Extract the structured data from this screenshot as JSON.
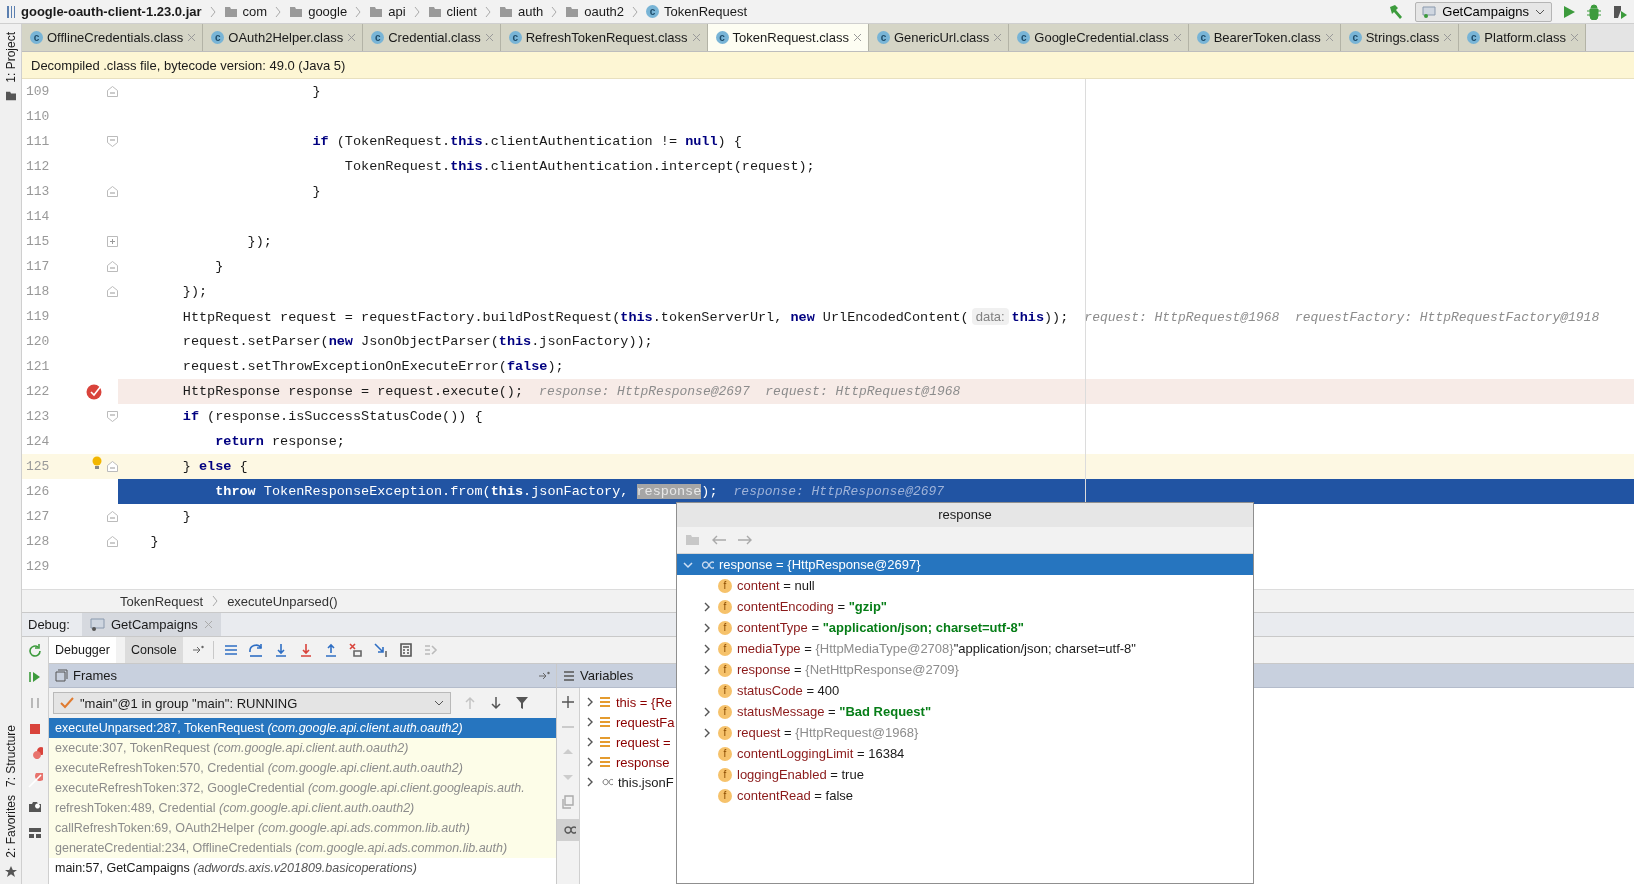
{
  "breadcrumb": {
    "root": "google-oauth-client-1.23.0.jar",
    "folders": [
      "com",
      "google",
      "api",
      "client",
      "auth",
      "oauth2"
    ],
    "class_icon": "c",
    "class_name": "TokenRequest"
  },
  "assign": "=",
  "run_config": "GetCampaigns",
  "left_strip": {
    "top": [
      "1: Project"
    ],
    "bottom": [
      "7: Structure",
      "2: Favorites"
    ]
  },
  "tabs": [
    {
      "icon": "c",
      "label": "OfflineCredentials.class",
      "selected": false
    },
    {
      "icon": "c",
      "label": "OAuth2Helper.class",
      "selected": false
    },
    {
      "icon": "c",
      "label": "Credential.class",
      "selected": false
    },
    {
      "icon": "c",
      "label": "RefreshTokenRequest.class",
      "selected": false
    },
    {
      "icon": "c",
      "label": "TokenRequest.class",
      "selected": true
    },
    {
      "icon": "c",
      "label": "GenericUrl.class",
      "selected": false
    },
    {
      "icon": "c",
      "label": "GoogleCredential.class",
      "selected": false
    },
    {
      "icon": "c",
      "label": "BearerToken.class",
      "selected": false
    },
    {
      "icon": "c",
      "label": "Strings.class",
      "selected": false
    },
    {
      "icon": "c",
      "label": "Platform.class",
      "selected": false
    }
  ],
  "banner": "Decompiled .class file, bytecode version: 49.0 (Java 5)",
  "code_lines": [
    {
      "number": "109",
      "kind": "plain",
      "fold": {
        "kind": "end"
      },
      "tokens": [
        {
          "kind": "plain",
          "t": "                        }"
        }
      ]
    },
    {
      "number": "110",
      "kind": "plain"
    },
    {
      "number": "111",
      "kind": "plain",
      "fold": {
        "kind": "start"
      },
      "tokens": [
        {
          "kind": "keyword",
          "t": "                        if"
        },
        {
          "kind": "plain",
          "t": " (TokenRequest."
        },
        {
          "kind": "keyword",
          "t": "this"
        },
        {
          "kind": "plain",
          "t": ".clientAuthentication != "
        },
        {
          "kind": "keyword",
          "t": "null"
        },
        {
          "kind": "plain",
          "t": ") {"
        }
      ]
    },
    {
      "number": "112",
      "kind": "plain",
      "tokens": [
        {
          "kind": "plain",
          "t": "                            TokenRequest."
        },
        {
          "kind": "keyword",
          "t": "this"
        },
        {
          "kind": "plain",
          "t": ".clientAuthentication.intercept(request);"
        }
      ]
    },
    {
      "number": "113",
      "kind": "plain",
      "fold": {
        "kind": "end"
      },
      "tokens": [
        {
          "kind": "plain",
          "t": "                        }"
        }
      ]
    },
    {
      "number": "114",
      "kind": "plain"
    },
    {
      "number": "115",
      "kind": "plain",
      "fold": {
        "kind": "collapsed"
      },
      "tokens": [
        {
          "kind": "plain",
          "t": "                });"
        }
      ]
    },
    {
      "number": "117",
      "kind": "plain",
      "fold": {
        "kind": "end"
      },
      "tokens": [
        {
          "kind": "plain",
          "t": "            }"
        }
      ]
    },
    {
      "number": "118",
      "kind": "plain",
      "fold": {
        "kind": "end"
      },
      "tokens": [
        {
          "kind": "plain",
          "t": "        });"
        }
      ]
    },
    {
      "number": "119",
      "kind": "plain",
      "tokens": [
        {
          "kind": "plain",
          "t": "        HttpRequest request = requestFactory.buildPostRequest("
        },
        {
          "kind": "keyword",
          "t": "this"
        },
        {
          "kind": "plain",
          "t": ".tokenServerUrl, "
        },
        {
          "kind": "keyword",
          "t": "new"
        },
        {
          "kind": "plain",
          "t": " UrlEncodedContent("
        },
        {
          "kind": "param",
          "t": "data:"
        },
        {
          "kind": "keyword",
          "t": "this"
        },
        {
          "kind": "plain",
          "t": "));"
        },
        {
          "kind": "hint",
          "t": "request: HttpRequest@1968  requestFactory: HttpRequestFactory@1918"
        }
      ]
    },
    {
      "number": "120",
      "kind": "plain",
      "tokens": [
        {
          "kind": "plain",
          "t": "        request.setParser("
        },
        {
          "kind": "keyword",
          "t": "new"
        },
        {
          "kind": "plain",
          "t": " JsonObjectParser("
        },
        {
          "kind": "keyword",
          "t": "this"
        },
        {
          "kind": "plain",
          "t": ".jsonFactory));"
        }
      ]
    },
    {
      "number": "121",
      "kind": "plain",
      "tokens": [
        {
          "kind": "plain",
          "t": "        request.setThrowExceptionOnExecuteError("
        },
        {
          "kind": "keyword",
          "t": "false"
        },
        {
          "kind": "plain",
          "t": ");"
        }
      ]
    },
    {
      "number": "122",
      "kind": "breakpoint",
      "marker": {
        "kind": "breakpoint"
      },
      "tokens": [
        {
          "kind": "plain",
          "t": "        HttpResponse response = request.execute();"
        },
        {
          "kind": "hint",
          "t": "response: HttpResponse@2697  request: HttpRequest@1968"
        }
      ]
    },
    {
      "number": "123",
      "kind": "plain",
      "fold": {
        "kind": "start"
      },
      "tokens": [
        {
          "kind": "keyword",
          "t": "        if"
        },
        {
          "kind": "plain",
          "t": " (response.isSuccessStatusCode()) {"
        }
      ]
    },
    {
      "number": "124",
      "kind": "plain",
      "tokens": [
        {
          "kind": "keyword",
          "t": "            return"
        },
        {
          "kind": "plain",
          "t": " response;"
        }
      ]
    },
    {
      "number": "125",
      "kind": "current",
      "marker": {
        "kind": "bulb"
      },
      "fold": {
        "kind": "end"
      },
      "tokens": [
        {
          "kind": "plain",
          "t": "        } "
        },
        {
          "kind": "keyword",
          "t": "else"
        },
        {
          "kind": "plain",
          "t": " {"
        }
      ]
    },
    {
      "number": "126",
      "kind": "execution",
      "tokens": [
        {
          "kind": "keyword",
          "t": "            throw"
        },
        {
          "kind": "plain",
          "t": " TokenResponseException.from("
        },
        {
          "kind": "keyword",
          "t": "this"
        },
        {
          "kind": "plain",
          "t": ".jsonFactory, "
        },
        {
          "kind": "selected",
          "t": "response"
        },
        {
          "kind": "plain",
          "t": ");"
        },
        {
          "kind": "hint",
          "t": "response: HttpResponse@2697"
        }
      ]
    },
    {
      "number": "127",
      "kind": "plain",
      "fold": {
        "kind": "end"
      },
      "tokens": [
        {
          "kind": "plain",
          "t": "        }"
        }
      ]
    },
    {
      "number": "128",
      "kind": "plain",
      "fold": {
        "kind": "end"
      },
      "tokens": [
        {
          "kind": "plain",
          "t": "    }"
        }
      ]
    },
    {
      "number": "129",
      "kind": "plain"
    }
  ],
  "code_breadcrumb": [
    "TokenRequest",
    "executeUnparsed()"
  ],
  "debug": {
    "label": "Debug:",
    "session": "GetCampaigns",
    "tabs": [
      {
        "label": "Debugger",
        "selected": true
      },
      {
        "label": "Console",
        "selected": false
      }
    ]
  },
  "frames": {
    "title": "Frames",
    "thread": "\"main\"@1 in group \"main\": RUNNING",
    "items": [
      {
        "method": "executeUnparsed:287, TokenRequest",
        "package": "(com.google.api.client.auth.oauth2)",
        "selected": true,
        "library": false
      },
      {
        "method": "execute:307, TokenRequest",
        "package": "(com.google.api.client.auth.oauth2)",
        "selected": false,
        "library": true
      },
      {
        "method": "executeRefreshToken:570, Credential",
        "package": "(com.google.api.client.auth.oauth2)",
        "selected": false,
        "library": true
      },
      {
        "method": "executeRefreshToken:372, GoogleCredential",
        "package": "(com.google.api.client.googleapis.auth.",
        "selected": false,
        "library": true
      },
      {
        "method": "refreshToken:489, Credential",
        "package": "(com.google.api.client.auth.oauth2)",
        "selected": false,
        "library": true
      },
      {
        "method": "callRefreshToken:69, OAuth2Helper",
        "package": "(com.google.api.ads.common.lib.auth)",
        "selected": false,
        "library": true
      },
      {
        "method": "generateCredential:234, OfflineCredentials",
        "package": "(com.google.api.ads.common.lib.auth)",
        "selected": false,
        "library": true
      },
      {
        "method": "main:57, GetCampaigns",
        "package": "(adwords.axis.v201809.basicoperations)",
        "selected": false,
        "library": false
      }
    ]
  },
  "variables": {
    "title": "Variables",
    "items": [
      {
        "kind": "field",
        "text": "this = {Re"
      },
      {
        "kind": "field",
        "text": "requestFa"
      },
      {
        "kind": "field",
        "text": "request ="
      },
      {
        "kind": "field",
        "text": "response"
      },
      {
        "kind": "watch",
        "text": "this.jsonF"
      }
    ]
  },
  "popup": {
    "title": "response",
    "root": {
      "text": "response = {HttpResponse@2697}",
      "expanded": true,
      "selected": true
    },
    "fields": [
      {
        "icon": "f",
        "name": "content",
        "value": "null",
        "kind": "plain",
        "expandable": false
      },
      {
        "icon": "f",
        "name": "contentEncoding",
        "value": "\"gzip\"",
        "kind": "string",
        "expandable": true
      },
      {
        "icon": "f",
        "name": "contentType",
        "value": "\"application/json; charset=utf-8\"",
        "kind": "string",
        "expandable": true
      },
      {
        "icon": "f",
        "name": "mediaType",
        "value": "{HttpMediaType@2708}",
        "kind": "ref",
        "extra": "\"application/json; charset=utf-8\"",
        "expandable": true
      },
      {
        "icon": "f",
        "name": "response",
        "value": "{NetHttpResponse@2709}",
        "kind": "ref",
        "expandable": true
      },
      {
        "icon": "f",
        "name": "statusCode",
        "value": "400",
        "kind": "plain",
        "expandable": false
      },
      {
        "icon": "f",
        "name": "statusMessage",
        "value": "\"Bad Request\"",
        "kind": "string",
        "expandable": true
      },
      {
        "icon": "f",
        "name": "request",
        "value": "{HttpRequest@1968}",
        "kind": "ref",
        "expandable": true
      },
      {
        "icon": "f",
        "name": "contentLoggingLimit",
        "value": "16384",
        "kind": "plain",
        "expandable": false
      },
      {
        "icon": "f",
        "name": "loggingEnabled",
        "value": "true",
        "kind": "plain",
        "expandable": false
      },
      {
        "icon": "f",
        "name": "contentRead",
        "value": "false",
        "kind": "plain",
        "expandable": false
      }
    ]
  }
}
